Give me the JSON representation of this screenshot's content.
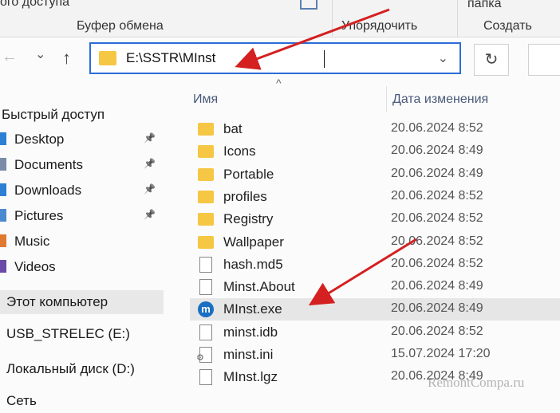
{
  "ribbon": {
    "partial_left": "ого доступа",
    "clipboard": "Буфер обмена",
    "organize": "Упорядочить",
    "new_folder_top": "папка",
    "create": "Создать"
  },
  "nav": {
    "back": "←",
    "recent": "⌄",
    "up": "↑",
    "address_path": "E:\\SSTR\\MInst",
    "refresh": "↻",
    "dropdown": "⌄"
  },
  "sidebar": {
    "quick_access": "Быстрый доступ",
    "items": [
      {
        "label": "Desktop",
        "icon": "desktop-icon",
        "color": "#2d7fd3",
        "pinned": true
      },
      {
        "label": "Documents",
        "icon": "documents-icon",
        "color": "#7a8ca8",
        "pinned": true
      },
      {
        "label": "Downloads",
        "icon": "downloads-icon",
        "color": "#2d7fd3",
        "pinned": true
      },
      {
        "label": "Pictures",
        "icon": "pictures-icon",
        "color": "#4a8ad0",
        "pinned": true
      },
      {
        "label": "Music",
        "icon": "music-icon",
        "color": "#e07a30",
        "pinned": false
      },
      {
        "label": "Videos",
        "icon": "videos-icon",
        "color": "#6b4aa8",
        "pinned": false
      }
    ],
    "this_pc": "Этот компьютер",
    "usb": "USB_STRELEC (E:)",
    "local_disk": "Локальный диск (D:)",
    "network": "Сеть",
    "pin_glyph": "📌"
  },
  "columns": {
    "name": "Имя",
    "date": "Дата изменения",
    "sort": "^"
  },
  "files": [
    {
      "name": "bat",
      "date": "20.06.2024 8:52",
      "type": "folder"
    },
    {
      "name": "Icons",
      "date": "20.06.2024 8:49",
      "type": "folder"
    },
    {
      "name": "Portable",
      "date": "20.06.2024 8:49",
      "type": "folder"
    },
    {
      "name": "profiles",
      "date": "20.06.2024 8:52",
      "type": "folder"
    },
    {
      "name": "Registry",
      "date": "20.06.2024 8:52",
      "type": "folder"
    },
    {
      "name": "Wallpaper",
      "date": "20.06.2024 8:52",
      "type": "folder"
    },
    {
      "name": "hash.md5",
      "date": "20.06.2024 8:52",
      "type": "file"
    },
    {
      "name": "Minst.About",
      "date": "20.06.2024 8:49",
      "type": "file"
    },
    {
      "name": "MInst.exe",
      "date": "20.06.2024 8:49",
      "type": "exe",
      "selected": true
    },
    {
      "name": "minst.idb",
      "date": "20.06.2024 8:52",
      "type": "file"
    },
    {
      "name": "minst.ini",
      "date": "15.07.2024 17:20",
      "type": "ini"
    },
    {
      "name": "MInst.lgz",
      "date": "20.06.2024 8:49",
      "type": "file"
    }
  ],
  "exe_glyph": "m",
  "watermark": "RemontCompa.ru",
  "colors": {
    "accent": "#2a6cd8",
    "arrow": "#d42020",
    "folder": "#f6c744"
  }
}
